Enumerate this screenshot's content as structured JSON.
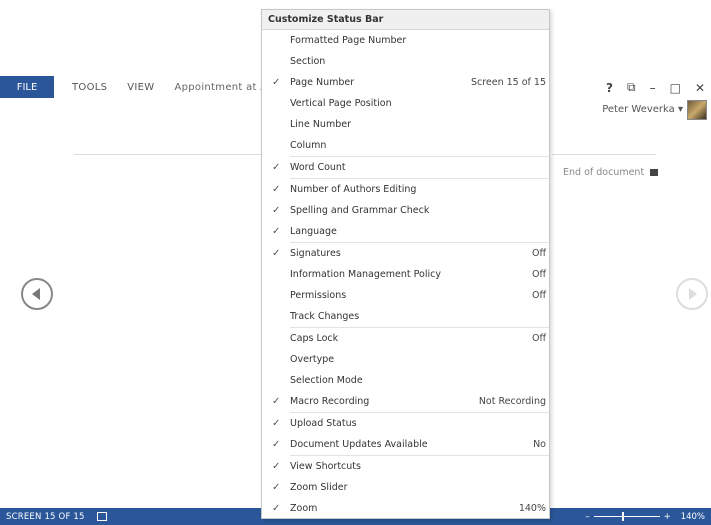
{
  "ribbon": {
    "tabs": [
      "FILE",
      "TOOLS",
      "VIEW"
    ],
    "document_title": "Appointment at A",
    "help": "?",
    "restore": "⧉",
    "minimize": "–",
    "maximize": "□",
    "close": "✕",
    "user_name": "Peter Weverka",
    "user_caret": "▾"
  },
  "document": {
    "end_label": "End of document"
  },
  "status_bar": {
    "page_info": "SCREEN 15 OF 15",
    "zoom_minus": "–",
    "zoom_plus": "+",
    "zoom_value": "140%"
  },
  "menu": {
    "title": "Customize Status Bar",
    "items": [
      {
        "label": "Formatted Page Number",
        "checked": false,
        "value": ""
      },
      {
        "label": "Section",
        "checked": false,
        "value": ""
      },
      {
        "label": "Page Number",
        "checked": true,
        "value": "Screen 15 of 15"
      },
      {
        "label": "Vertical Page Position",
        "checked": false,
        "value": ""
      },
      {
        "label": "Line Number",
        "checked": false,
        "value": ""
      },
      {
        "label": "Column",
        "checked": false,
        "value": ""
      },
      {
        "label": "Word Count",
        "checked": true,
        "value": ""
      },
      {
        "label": "Number of Authors Editing",
        "checked": true,
        "value": ""
      },
      {
        "label": "Spelling and Grammar Check",
        "checked": true,
        "value": ""
      },
      {
        "label": "Language",
        "checked": true,
        "value": ""
      },
      {
        "label": "Signatures",
        "checked": true,
        "value": "Off"
      },
      {
        "label": "Information Management Policy",
        "checked": false,
        "value": "Off"
      },
      {
        "label": "Permissions",
        "checked": false,
        "value": "Off"
      },
      {
        "label": "Track Changes",
        "checked": false,
        "value": ""
      },
      {
        "label": "Caps Lock",
        "checked": false,
        "value": "Off"
      },
      {
        "label": "Overtype",
        "checked": false,
        "value": ""
      },
      {
        "label": "Selection Mode",
        "checked": false,
        "value": ""
      },
      {
        "label": "Macro Recording",
        "checked": true,
        "value": "Not Recording"
      },
      {
        "label": "Upload Status",
        "checked": true,
        "value": ""
      },
      {
        "label": "Document Updates Available",
        "checked": true,
        "value": "No"
      },
      {
        "label": "View Shortcuts",
        "checked": true,
        "value": ""
      },
      {
        "label": "Zoom Slider",
        "checked": true,
        "value": ""
      },
      {
        "label": "Zoom",
        "checked": true,
        "value": "140%"
      }
    ],
    "check_glyph": "✓"
  }
}
